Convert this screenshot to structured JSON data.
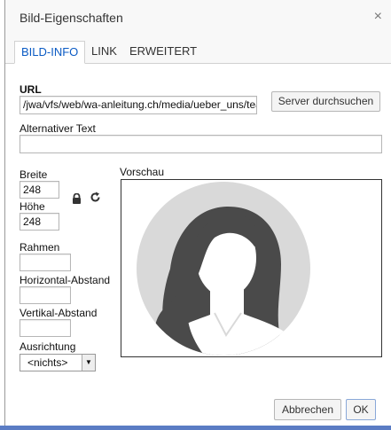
{
  "dialog": {
    "title": "Bild-Eigenschaften",
    "close_glyph": "×"
  },
  "tabs": [
    {
      "label": "BILD-INFO",
      "active": true
    },
    {
      "label": "LINK",
      "active": false
    },
    {
      "label": "ERWEITERT",
      "active": false
    }
  ],
  "url": {
    "label": "URL",
    "value": "/jwa/vfs/web/wa-anleitung.ch/media/ueber_uns/tea",
    "browse_button": "Server durchsuchen"
  },
  "alt_text": {
    "label": "Alternativer Text",
    "value": ""
  },
  "width": {
    "label": "Breite",
    "value": "248"
  },
  "height": {
    "label": "Höhe",
    "value": "248"
  },
  "lock_icon": "lock-icon",
  "reset_icon": "reset-size-icon",
  "preview": {
    "label": "Vorschau"
  },
  "border": {
    "label": "Rahmen",
    "value": ""
  },
  "hspace": {
    "label": "Horizontal-Abstand",
    "value": ""
  },
  "vspace": {
    "label": "Vertikal-Abstand",
    "value": ""
  },
  "align": {
    "label": "Ausrichtung",
    "selected": "<nichts>"
  },
  "footer": {
    "cancel": "Abbrechen",
    "ok": "OK"
  }
}
